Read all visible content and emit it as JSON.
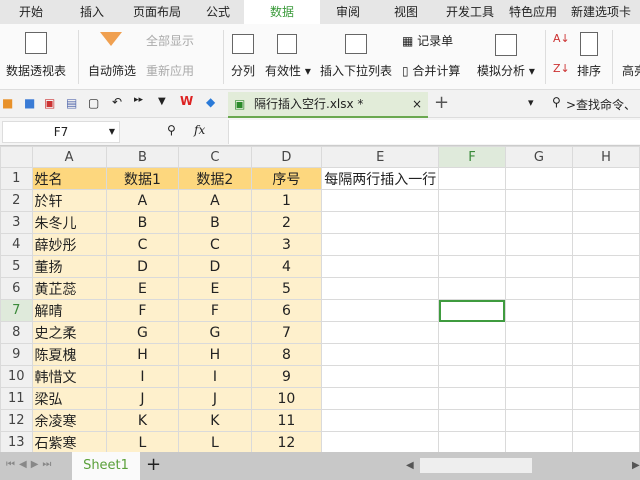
{
  "menu": [
    "开始",
    "插入",
    "页面布局",
    "公式",
    "数据",
    "审阅",
    "视图",
    "开发工具",
    "特色应用",
    "新建选项卡"
  ],
  "ribbon": {
    "pivot": "数据透视表",
    "autofilter": "自动筛选",
    "show_all": "全部显示",
    "reapply": "重新应用",
    "split": "分列",
    "validity": "有效性",
    "insert_dropdown": "插入下拉列表",
    "record": "记录单",
    "consolidate": "合并计算",
    "whatif": "模拟分析",
    "sort": "排序",
    "highlight": "高亮"
  },
  "quick": {
    "file_tab": "隔行插入空行.xlsx *",
    "search": ">查找命令、"
  },
  "formula_bar": {
    "name_box": "F7",
    "fx": "fx",
    "value": ""
  },
  "columns": [
    "A",
    "B",
    "C",
    "D",
    "E",
    "F",
    "G",
    "H"
  ],
  "rows": [
    [
      "姓名",
      "数据1",
      "数据2",
      "序号",
      "每隔两行插入一行"
    ],
    [
      "於轩",
      "A",
      "A",
      "1",
      ""
    ],
    [
      "朱冬儿",
      "B",
      "B",
      "2",
      ""
    ],
    [
      "薛妙彤",
      "C",
      "C",
      "3",
      ""
    ],
    [
      "董扬",
      "D",
      "D",
      "4",
      ""
    ],
    [
      "黄芷蕊",
      "E",
      "E",
      "5",
      ""
    ],
    [
      "解晴",
      "F",
      "F",
      "6",
      ""
    ],
    [
      "史之柔",
      "G",
      "G",
      "7",
      ""
    ],
    [
      "陈夏槐",
      "H",
      "H",
      "8",
      ""
    ],
    [
      "韩惜文",
      "I",
      "I",
      "9",
      ""
    ],
    [
      "梁弘",
      "J",
      "J",
      "10",
      ""
    ],
    [
      "余凌寒",
      "K",
      "K",
      "11",
      ""
    ],
    [
      "石紫寒",
      "L",
      "L",
      "12",
      ""
    ]
  ],
  "sheet_tab": "Sheet1"
}
